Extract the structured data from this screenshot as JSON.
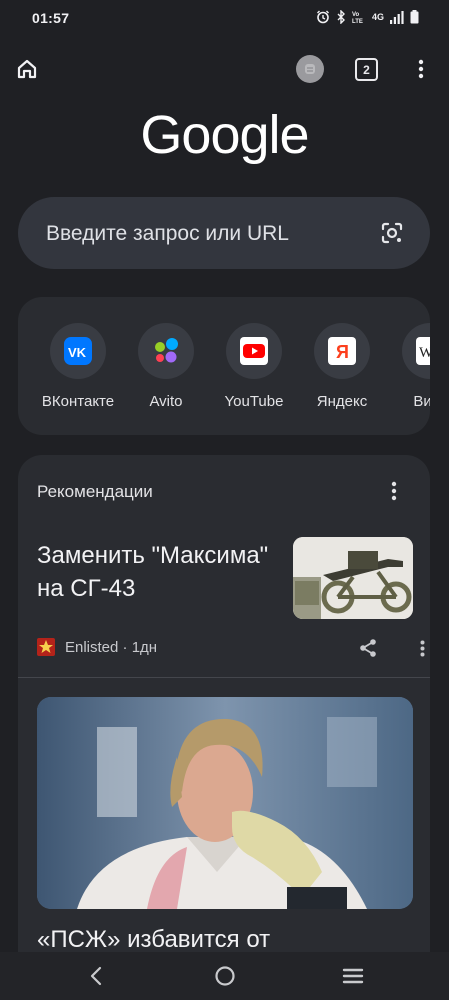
{
  "status_bar": {
    "time": "01:57",
    "network": "4G",
    "icons": [
      "alarm-icon",
      "bluetooth-icon",
      "volte-icon",
      "signal-icon",
      "battery-icon"
    ]
  },
  "toolbar": {
    "tab_count": "2",
    "icons": [
      "home-icon",
      "account-avatar",
      "tabs-icon",
      "overflow-menu-icon"
    ]
  },
  "logo": {
    "text": "Google"
  },
  "search": {
    "placeholder": "Введите запрос или URL",
    "icon": "camera-lens-icon"
  },
  "shortcuts": [
    {
      "label": "ВКонтакте",
      "icon": "vk-icon",
      "color": "#0077ff"
    },
    {
      "label": "Avito",
      "icon": "avito-icon",
      "color": "#97cf26"
    },
    {
      "label": "YouTube",
      "icon": "youtube-icon",
      "color": "#ff0000"
    },
    {
      "label": "Яндекс",
      "icon": "yandex-icon",
      "color": "#fc3f1d"
    },
    {
      "label": "Вики",
      "icon": "wikipedia-icon",
      "color": "#ffffff"
    }
  ],
  "feed": {
    "heading": "Рекомендации",
    "articles": [
      {
        "title": "Заменить \"Максима\" на СГ-43",
        "source": "Enlisted · 1дн"
      },
      {
        "title": "«ПСЖ» избавится от"
      }
    ]
  },
  "nav_bar": {
    "icons": [
      "back-icon",
      "home-circle-icon",
      "recents-icon"
    ]
  },
  "colors": {
    "background": "#1f2024",
    "card": "#2a2c31",
    "search": "#33363e"
  }
}
